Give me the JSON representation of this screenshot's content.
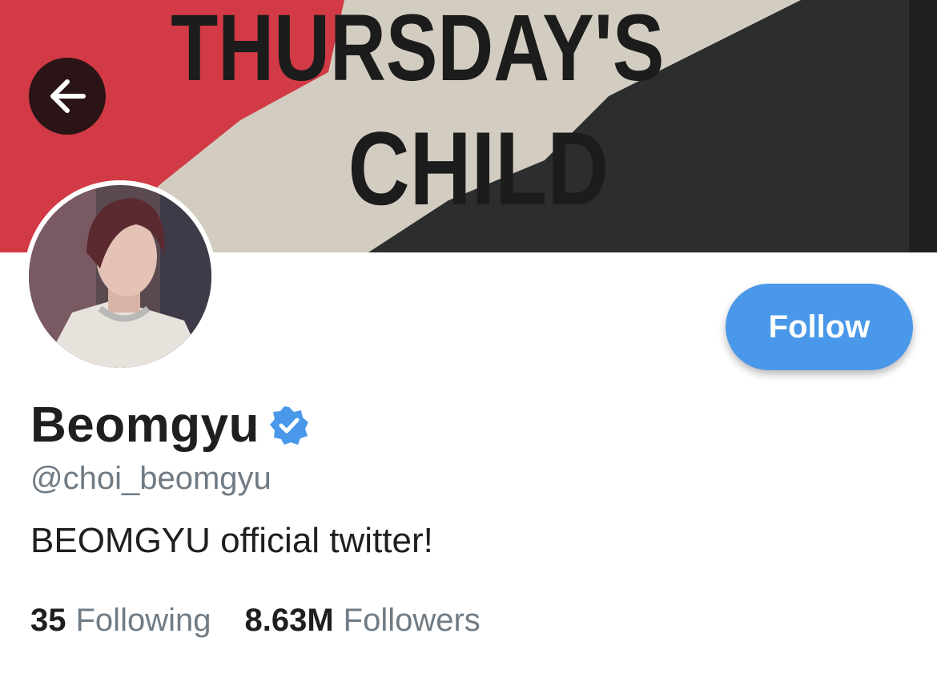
{
  "header": {
    "banner_text_line1": "THURSDAY'S",
    "banner_text_line2": "CHILD",
    "colors": {
      "red": "#d23a45",
      "beige": "#d3cdc1",
      "dark": "#2b2d2f",
      "lettering": "#1c1c1c"
    }
  },
  "navigation": {
    "back_icon": "arrow-left-icon"
  },
  "profile": {
    "display_name": "Beomgyu",
    "verified_icon": "verified-badge-icon",
    "handle": "@choi_beomgyu",
    "bio": "BEOMGYU official twitter!",
    "follow_label": "Follow",
    "following_count": "35",
    "following_label": "Following",
    "followers_count": "8.63M",
    "followers_label": "Followers"
  },
  "theme": {
    "accent": "#4a98ea",
    "text": "#1f1f1f",
    "muted": "#6f7b85"
  }
}
